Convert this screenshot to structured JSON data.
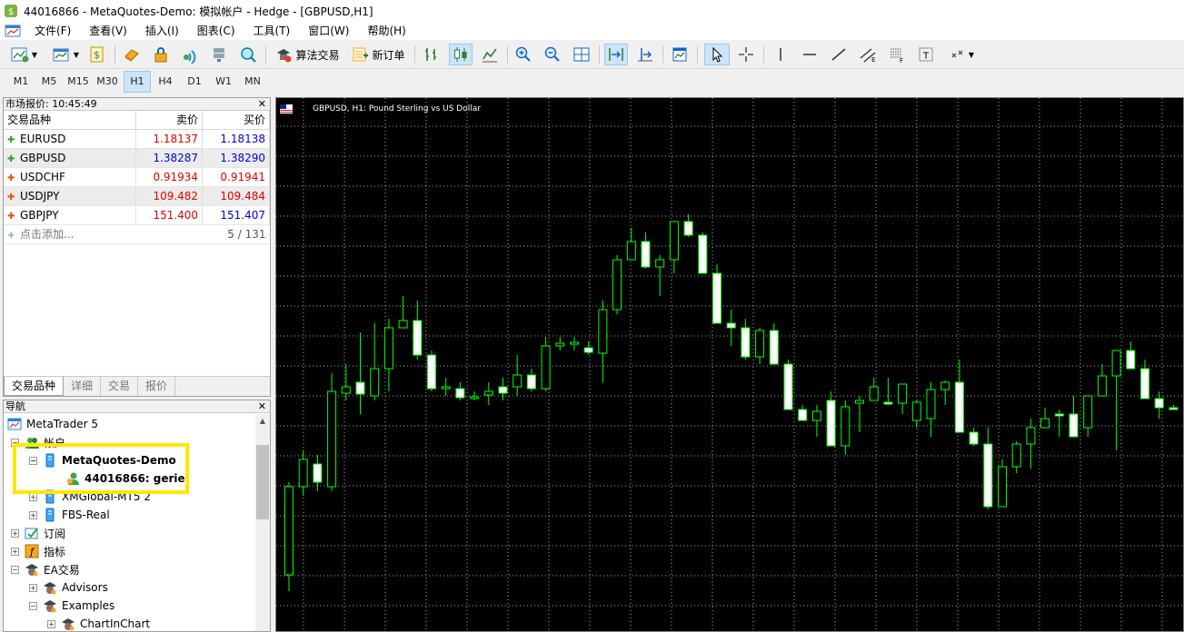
{
  "titlebar": {
    "title": "44016866 - MetaQuotes-Demo: 模拟帐户 - Hedge - [GBPUSD,H1]"
  },
  "menu": [
    {
      "label": "文件(F)"
    },
    {
      "label": "查看(V)"
    },
    {
      "label": "插入(I)"
    },
    {
      "label": "图表(C)"
    },
    {
      "label": "工具(T)"
    },
    {
      "label": "窗口(W)"
    },
    {
      "label": "帮助(H)"
    }
  ],
  "toolbar": {
    "algo_trading": "算法交易",
    "new_order": "新订单"
  },
  "timeframes": [
    {
      "label": "M1"
    },
    {
      "label": "M5"
    },
    {
      "label": "M15"
    },
    {
      "label": "M30"
    },
    {
      "label": "H1",
      "active": true
    },
    {
      "label": "H4"
    },
    {
      "label": "D1"
    },
    {
      "label": "W1"
    },
    {
      "label": "MN"
    }
  ],
  "market_watch": {
    "header": "市场报价: 10:45:49",
    "col_symbol": "交易品种",
    "col_bid": "卖价",
    "col_ask": "买价",
    "rows": [
      {
        "symbol": "EURUSD",
        "bid": "1.18137",
        "ask": "1.18138",
        "dir": "up"
      },
      {
        "symbol": "GBPUSD",
        "bid": "1.38287",
        "ask": "1.38290",
        "dir": "up"
      },
      {
        "symbol": "USDCHF",
        "bid": "0.91934",
        "ask": "0.91941",
        "dir": "down"
      },
      {
        "symbol": "USDJPY",
        "bid": "109.482",
        "ask": "109.484",
        "dir": "down"
      },
      {
        "symbol": "GBPJPY",
        "bid": "151.400",
        "ask": "151.407",
        "dir": "down"
      }
    ],
    "add_label": "点击添加...",
    "count": "5 / 131",
    "tabs": [
      {
        "label": "交易品种"
      },
      {
        "label": "详细"
      },
      {
        "label": "交易"
      },
      {
        "label": "报价"
      }
    ]
  },
  "navigator": {
    "header": "导航",
    "items": [
      {
        "label": "MetaTrader 5"
      },
      {
        "label": "帐户"
      },
      {
        "label": "MetaQuotes-Demo"
      },
      {
        "label": "44016866: gerie"
      },
      {
        "label": "XMGlobal-MT5 2"
      },
      {
        "label": "FBS-Real"
      },
      {
        "label": "订阅"
      },
      {
        "label": "指标"
      },
      {
        "label": "EA交易"
      },
      {
        "label": "Advisors"
      },
      {
        "label": "Examples"
      },
      {
        "label": "ChartInChart"
      }
    ]
  },
  "chart": {
    "title": "GBPUSD, H1:  Pound Sterling vs US Dollar",
    "colors": {
      "background": "#000000",
      "grid": "#d8d8d8",
      "bull_fill": "#000000",
      "bear_fill": "#ffffff",
      "wick": "#00ff00"
    }
  },
  "chart_data": {
    "type": "candlestick",
    "symbol": "GBPUSD",
    "timeframe": "H1",
    "title": "GBPUSD, H1:  Pound Sterling vs US Dollar",
    "grid": true,
    "candles": [
      {
        "open": 632,
        "high": 650,
        "low": 530,
        "close": 535
      },
      {
        "open": 535,
        "high": 545,
        "low": 495,
        "close": 505
      },
      {
        "open": 510,
        "high": 540,
        "low": 500,
        "close": 530
      },
      {
        "open": 535,
        "high": 540,
        "low": 410,
        "close": 430
      },
      {
        "open": 432,
        "high": 440,
        "low": 400,
        "close": 425
      },
      {
        "open": 420,
        "high": 455,
        "low": 365,
        "close": 433
      },
      {
        "open": 435,
        "high": 440,
        "low": 355,
        "close": 405
      },
      {
        "open": 405,
        "high": 430,
        "low": 350,
        "close": 360
      },
      {
        "open": 360,
        "high": 345,
        "low": 325,
        "close": 352
      },
      {
        "open": 352,
        "high": 395,
        "low": 330,
        "close": 390
      },
      {
        "open": 390,
        "high": 430,
        "low": 385,
        "close": 427
      },
      {
        "open": 427,
        "high": 435,
        "low": 415,
        "close": 425
      },
      {
        "open": 427,
        "high": 440,
        "low": 420,
        "close": 437
      },
      {
        "open": 437,
        "high": 440,
        "low": 430,
        "close": 436
      },
      {
        "open": 434,
        "high": 445,
        "low": 420,
        "close": 430
      },
      {
        "open": 425,
        "high": 440,
        "low": 415,
        "close": 432
      },
      {
        "open": 425,
        "high": 435,
        "low": 390,
        "close": 412
      },
      {
        "open": 412,
        "high": 430,
        "low": 405,
        "close": 427
      },
      {
        "open": 427,
        "high": 430,
        "low": 370,
        "close": 380
      },
      {
        "open": 380,
        "high": 385,
        "low": 370,
        "close": 377
      },
      {
        "open": 377,
        "high": 385,
        "low": 370,
        "close": 376
      },
      {
        "open": 382,
        "high": 390,
        "low": 375,
        "close": 387
      },
      {
        "open": 388,
        "high": 420,
        "low": 330,
        "close": 340
      },
      {
        "open": 340,
        "high": 345,
        "low": 280,
        "close": 285
      },
      {
        "open": 285,
        "high": 255,
        "low": 250,
        "close": 265
      },
      {
        "open": 265,
        "high": 295,
        "low": 255,
        "close": 293
      },
      {
        "open": 293,
        "high": 325,
        "low": 280,
        "close": 285
      },
      {
        "open": 285,
        "high": 300,
        "low": 250,
        "close": 243
      },
      {
        "open": 243,
        "high": 260,
        "low": 235,
        "close": 258
      },
      {
        "open": 258,
        "high": 300,
        "low": 255,
        "close": 300
      },
      {
        "open": 300,
        "high": 355,
        "low": 290,
        "close": 355
      },
      {
        "open": 355,
        "high": 380,
        "low": 340,
        "close": 360
      },
      {
        "open": 360,
        "high": 395,
        "low": 350,
        "close": 392
      },
      {
        "open": 392,
        "high": 400,
        "low": 360,
        "close": 363
      },
      {
        "open": 363,
        "high": 400,
        "low": 355,
        "close": 400
      },
      {
        "open": 400,
        "high": 415,
        "low": 395,
        "close": 450
      },
      {
        "open": 450,
        "high": 460,
        "low": 445,
        "close": 462
      },
      {
        "open": 462,
        "high": 480,
        "low": 445,
        "close": 452
      },
      {
        "open": 440,
        "high": 490,
        "low": 430,
        "close": 490
      },
      {
        "open": 490,
        "high": 500,
        "low": 440,
        "close": 447
      },
      {
        "open": 443,
        "high": 475,
        "low": 435,
        "close": 440
      },
      {
        "open": 440,
        "high": 420,
        "low": 415,
        "close": 425
      },
      {
        "open": 442,
        "high": 445,
        "low": 415,
        "close": 443
      },
      {
        "open": 443,
        "high": 455,
        "low": 425,
        "close": 422
      },
      {
        "open": 462,
        "high": 470,
        "low": 440,
        "close": 442
      },
      {
        "open": 460,
        "high": 480,
        "low": 420,
        "close": 428
      },
      {
        "open": 428,
        "high": 445,
        "low": 418,
        "close": 420
      },
      {
        "open": 420,
        "high": 400,
        "low": 395,
        "close": 475
      },
      {
        "open": 475,
        "high": 490,
        "low": 470,
        "close": 488
      },
      {
        "open": 488,
        "high": 560,
        "low": 470,
        "close": 557
      },
      {
        "open": 557,
        "high": 520,
        "low": 505,
        "close": 513
      },
      {
        "open": 513,
        "high": 520,
        "low": 485,
        "close": 488
      },
      {
        "open": 488,
        "high": 515,
        "low": 460,
        "close": 470
      },
      {
        "open": 470,
        "high": 450,
        "low": 448,
        "close": 460
      },
      {
        "open": 455,
        "high": 480,
        "low": 450,
        "close": 455
      },
      {
        "open": 455,
        "high": 465,
        "low": 435,
        "close": 480
      },
      {
        "open": 470,
        "high": 480,
        "low": 450,
        "close": 435
      },
      {
        "open": 435,
        "high": 420,
        "low": 400,
        "close": 413
      },
      {
        "open": 413,
        "high": 495,
        "low": 400,
        "close": 385
      },
      {
        "open": 385,
        "high": 380,
        "low": 375,
        "close": 405
      },
      {
        "open": 405,
        "high": 400,
        "low": 395,
        "close": 438
      },
      {
        "open": 438,
        "high": 460,
        "low": 430,
        "close": 448
      },
      {
        "open": 448,
        "high": 450,
        "low": 445,
        "close": 449
      },
      {
        "open": 449,
        "high": 440,
        "low": 435,
        "close": 440
      },
      {
        "open": 440,
        "high": 425,
        "low": 420,
        "close": 425
      },
      {
        "open": 425,
        "high": 415,
        "low": 410,
        "close": 435
      }
    ]
  }
}
